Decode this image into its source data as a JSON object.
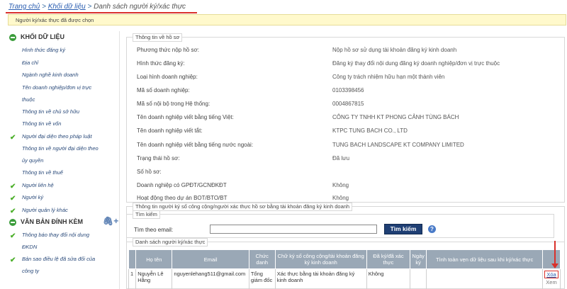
{
  "breadcrumb": {
    "home": "Trang chủ",
    "data": "Khối dữ liệu",
    "current": "Danh sách người ký/xác thực"
  },
  "notice": "Người ký/xác thực đã được chọn",
  "sidebar": {
    "section1": "KHỐI DỮ LIỆU",
    "items": [
      {
        "lines": [
          "Hình thức đăng ký"
        ],
        "checked": false
      },
      {
        "lines": [
          "Địa chỉ"
        ],
        "checked": false
      },
      {
        "lines": [
          "Ngành nghề kinh doanh"
        ],
        "checked": false
      },
      {
        "lines": [
          "Tên doanh nghiệp/đơn vị trực",
          "thuộc"
        ],
        "checked": false
      },
      {
        "lines": [
          "Thông tin về chủ sở hữu"
        ],
        "checked": false
      },
      {
        "lines": [
          "Thông tin về vốn"
        ],
        "checked": false
      },
      {
        "lines": [
          "Người đại diện theo pháp luật"
        ],
        "checked": true
      },
      {
        "lines": [
          "Thông tin về người đại diện theo",
          "ủy quyền"
        ],
        "checked": false
      },
      {
        "lines": [
          "Thông tin về thuế"
        ],
        "checked": false
      },
      {
        "lines": [
          "Người liên hệ"
        ],
        "checked": true
      },
      {
        "lines": [
          "Người ký"
        ],
        "checked": true
      },
      {
        "lines": [
          "Người quản lý khác"
        ],
        "checked": true
      }
    ],
    "section2": "VĂN BẢN ĐÍNH KÈM",
    "items2": [
      {
        "lines": [
          "Thông báo thay đổi nội dung",
          "ĐKDN"
        ],
        "checked": true
      },
      {
        "lines": [
          "Bản sao điều lệ đã sửa đổi của",
          "công ty"
        ],
        "checked": true
      }
    ]
  },
  "info": {
    "legend": "Thông tin về hồ sơ",
    "rows": [
      {
        "label": "Phương thức nộp hồ sơ:",
        "value": "Nộp hồ sơ sử dụng tài khoản đăng ký kinh doanh"
      },
      {
        "label": "Hình thức đăng ký:",
        "value": "Đăng ký thay đổi nội dung đăng ký doanh nghiệp/đơn vị trực thuộc"
      },
      {
        "label": "Loại hình doanh nghiệp:",
        "value": "Công ty trách nhiệm hữu hạn một thành viên"
      },
      {
        "label": "Mã số doanh nghiệp:",
        "value": "0103398456"
      },
      {
        "label": "Mã số nội bộ trong Hệ thống:",
        "value": "0004867815"
      },
      {
        "label": "Tên doanh nghiệp viết bằng tiếng Việt:",
        "value": "CÔNG TY TNHH KT PHONG CẢNH TÙNG BÁCH"
      },
      {
        "label": "Tên doanh nghiệp viết tắt:",
        "value": "KTPC TUNG BACH CO., LTD"
      },
      {
        "label": "Tên doanh nghiệp viết bằng tiếng nước ngoài:",
        "value": "TUNG BACH LANDSCAPE KT COMPANY LIMITED"
      },
      {
        "label": "Trạng thái hồ sơ:",
        "value": "Đã lưu"
      },
      {
        "label": "Số hồ sơ:",
        "value": ""
      },
      {
        "label": "Doanh nghiệp có GPĐT/GCNĐKĐT",
        "value": "Không"
      },
      {
        "label": "Hoạt động theo dự án BOT/BTO/BT",
        "value": "Không"
      }
    ]
  },
  "signers": {
    "legend": "Thông tin người ký số công cộng/người xác thực hồ sơ bằng tài khoản đăng ký kinh doanh",
    "search_legend": "Tìm kiếm",
    "search_label": "Tìm theo email:",
    "search_value": "",
    "search_button": "Tìm kiếm",
    "help": "?",
    "list_legend": "Danh sách người ký/xác thực",
    "columns": [
      "",
      "Họ tên",
      "Email",
      "Chức danh",
      "Chữ ký số công cộng/tài khoản đăng ký kinh doanh",
      "Đã ký/đã xác thực",
      "Ngày ký",
      "Tình toàn vẹn dữ liệu sau khi ký/xác thực",
      ""
    ],
    "rows": [
      {
        "no": "1",
        "name": "Nguyễn Lê Hằng",
        "email": "nguyenlehang511@gmail.com",
        "title": "Tổng giám đốc",
        "sig": "Xác thực bằng tài khoản đăng ký kinh doanh",
        "signed": "Không",
        "date": "",
        "integrity": "",
        "delete": "Xóa",
        "view": "Xem"
      }
    ]
  }
}
